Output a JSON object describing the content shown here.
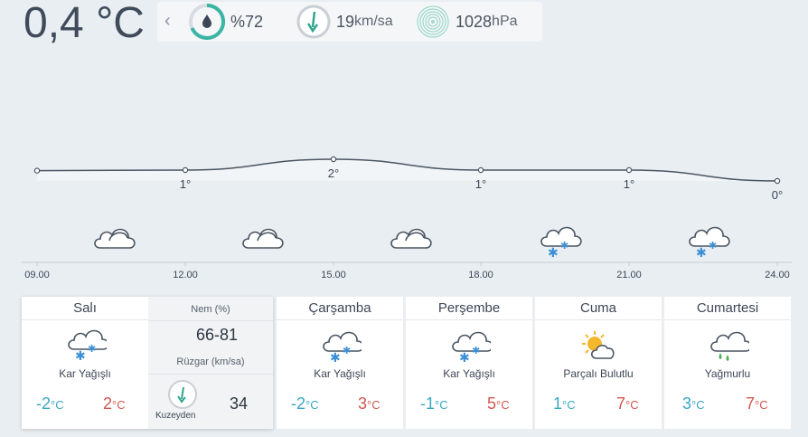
{
  "current": {
    "temperature": "0,4 °C"
  },
  "stats": {
    "humidity": "%72",
    "wind_value": "19",
    "wind_unit": "km/sa",
    "pressure_value": "1028",
    "pressure_unit": "hPa"
  },
  "chart_data": {
    "type": "line",
    "x": [
      "09.00",
      "12.00",
      "15.00",
      "18.00",
      "21.00",
      "24.00"
    ],
    "values": [
      null,
      1,
      2,
      1,
      1,
      0
    ],
    "point_labels": [
      "",
      "1°",
      "2°",
      "1°",
      "1°",
      "0°"
    ],
    "icons": [
      "",
      "cloudy-icon",
      "cloudy-icon",
      "cloudy-icon",
      "snow-cloud-icon",
      "snow-cloud-icon"
    ]
  },
  "today": {
    "day": "Salı",
    "condition": "Kar Yağışlı",
    "min": "-2",
    "max": "2",
    "unit": "°C",
    "humidity_label": "Nem (%)",
    "humidity_range": "66-81",
    "wind_label": "Rüzgar (km/sa)",
    "wind_dir": "Kuzeyden",
    "wind_speed": "34"
  },
  "forecast": [
    {
      "day": "Çarşamba",
      "condition": "Kar Yağışlı",
      "min": "-2",
      "max": "3",
      "unit": "°C",
      "icon": "snow-cloud-icon"
    },
    {
      "day": "Perşembe",
      "condition": "Kar Yağışlı",
      "min": "-1",
      "max": "5",
      "unit": "°C",
      "icon": "snow-cloud-icon"
    },
    {
      "day": "Cuma",
      "condition": "Parçalı Bulutlu",
      "min": "1",
      "max": "7",
      "unit": "°C",
      "icon": "partly-cloudy-icon"
    },
    {
      "day": "Cumartesi",
      "condition": "Yağmurlu",
      "min": "3",
      "max": "7",
      "unit": "°C",
      "icon": "rain-cloud-icon"
    }
  ]
}
